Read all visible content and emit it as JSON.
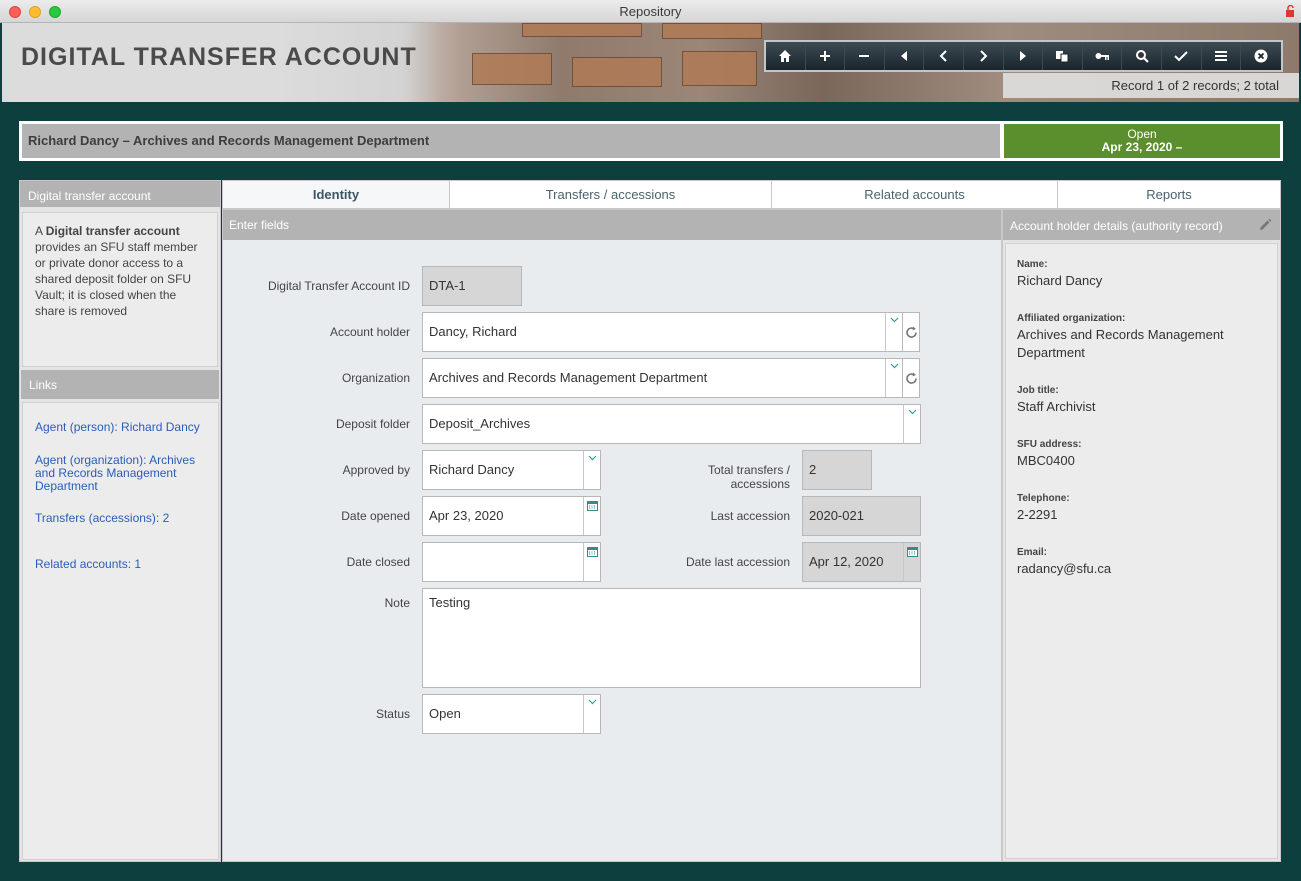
{
  "window": {
    "title": "Repository"
  },
  "header": {
    "title": "DIGITAL TRANSFER ACCOUNT",
    "record_info": "Record 1 of 2 records; 2 total",
    "toolbar": [
      "home-icon",
      "plus-icon",
      "minus-icon",
      "first-record-icon",
      "previous-record-icon",
      "next-record-icon",
      "last-record-icon",
      "duplicate-icon",
      "key-icon",
      "search-icon",
      "checkmark-icon",
      "menu-icon",
      "close-icon"
    ]
  },
  "banner": {
    "title": "Richard Dancy – Archives and Records Management Department",
    "status": "Open",
    "date_range": "Apr 23, 2020 –"
  },
  "left_panel": {
    "title": "Digital transfer account",
    "desc_a": "A ",
    "desc_bold": "Digital transfer account",
    "desc_rest": " provides an SFU staff member or private donor access to a shared deposit folder on SFU Vault; it is closed when the share is removed",
    "links_title": "Links",
    "links": [
      "Agent (person): Richard Dancy",
      "Agent (organization): Archives and Records Management Department",
      "Transfers (accessions): 2",
      "Related accounts: 1"
    ]
  },
  "tabs": [
    "Identity",
    "Transfers / accessions",
    "Related accounts",
    "Reports"
  ],
  "form": {
    "section_title": "Enter fields",
    "account_id_label": "Digital Transfer Account ID",
    "account_id": "DTA-1",
    "account_holder_label": "Account holder",
    "account_holder": "Dancy, Richard",
    "organization_label": "Organization",
    "organization": "Archives and Records Management Department",
    "deposit_folder_label": "Deposit folder",
    "deposit_folder": "Deposit_Archives",
    "approved_by_label": "Approved by",
    "approved_by": "Richard Dancy",
    "total_transfers_label": "Total transfers / accessions",
    "total_transfers": "2",
    "date_opened_label": "Date opened",
    "date_opened": "Apr 23, 2020",
    "last_accession_label": "Last accession",
    "last_accession": "2020-021",
    "date_closed_label": "Date closed",
    "date_closed": "",
    "date_last_accession_label": "Date last accession",
    "date_last_accession": "Apr 12, 2020",
    "note_label": "Note",
    "note": "Testing",
    "status_label": "Status",
    "status": "Open"
  },
  "authority": {
    "title": "Account holder details (authority record)",
    "name_label": "Name:",
    "name": "Richard Dancy",
    "org_label": "Affiliated organization:",
    "org": "Archives and Records Management Department",
    "job_label": "Job title:",
    "job": "Staff Archivist",
    "address_label": "SFU address:",
    "address": "MBC0400",
    "phone_label": "Telephone:",
    "phone": "2-2291",
    "email_label": "Email:",
    "email": "radancy@sfu.ca"
  },
  "colors": {
    "status_open": "#5b8e2c",
    "background": "#0d3f3f",
    "link": "#2a5db8"
  }
}
